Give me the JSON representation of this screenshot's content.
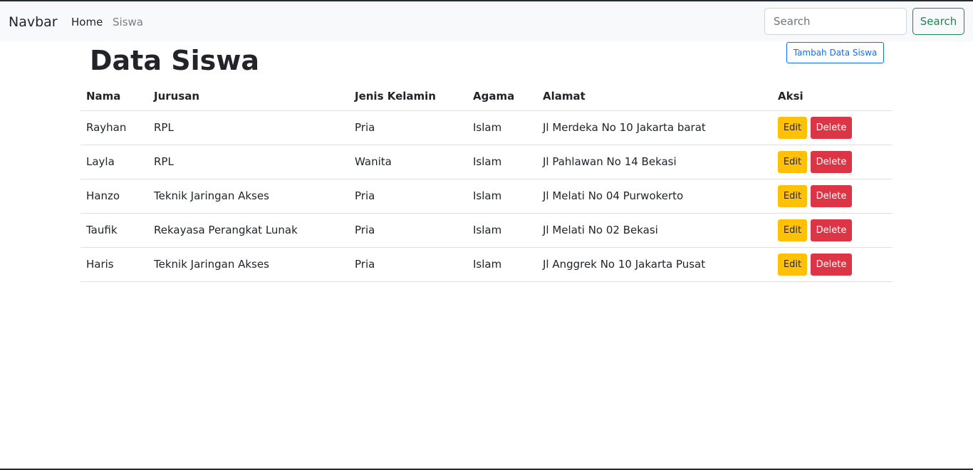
{
  "navbar": {
    "brand": "Navbar",
    "links": [
      "Home",
      "Siswa"
    ],
    "search_placeholder": "Search",
    "search_button": "Search"
  },
  "page": {
    "title": "Data Siswa",
    "add_button": "Tambah Data Siswa"
  },
  "table": {
    "headers": [
      "Nama",
      "Jurusan",
      "Jenis Kelamin",
      "Agama",
      "Alamat",
      "Aksi"
    ],
    "edit_label": "Edit",
    "delete_label": "Delete",
    "rows": [
      [
        "Rayhan",
        "RPL",
        "Pria",
        "Islam",
        "Jl Merdeka No 10 Jakarta barat"
      ],
      [
        "Layla",
        "RPL",
        "Wanita",
        "Islam",
        "Jl Pahlawan No 14 Bekasi"
      ],
      [
        "Hanzo",
        "Teknik Jaringan Akses",
        "Pria",
        "Islam",
        "Jl Melati No 04 Purwokerto"
      ],
      [
        "Taufik",
        "Rekayasa Perangkat Lunak",
        "Pria",
        "Islam",
        "Jl Melati No 02 Bekasi"
      ],
      [
        "Haris",
        "Teknik Jaringan Akses",
        "Pria",
        "Islam",
        "Jl Anggrek No 10 Jakarta Pusat"
      ]
    ]
  },
  "colors": {
    "primary": "#0d6efd",
    "success": "#198754",
    "warning": "#ffc107",
    "danger": "#dc3545",
    "navbar_bg": "#f8f9fa"
  }
}
